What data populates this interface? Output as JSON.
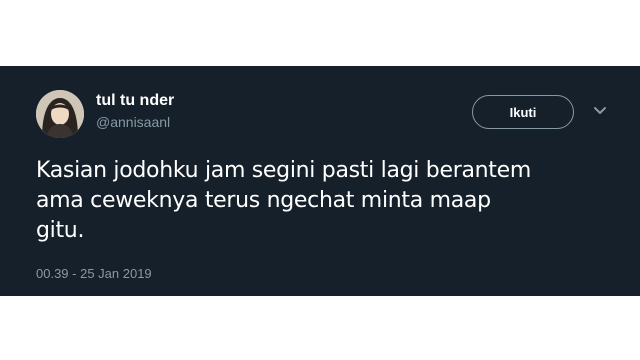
{
  "tweet": {
    "display_name": "tul tu nder",
    "handle": "@annisaanl",
    "follow_label": "Ikuti",
    "text": "Kasian jodohku jam segini pasti lagi berantem\nama ceweknya terus ngechat minta maap\ngitu.",
    "timestamp": "00.39 - 25 Jan 2019"
  },
  "icons": {
    "avatar": "avatar-photo",
    "menu": "chevron-down-icon"
  },
  "colors": {
    "background": "#15202b",
    "primary_text": "#ffffff",
    "secondary_text": "#8899a6"
  }
}
